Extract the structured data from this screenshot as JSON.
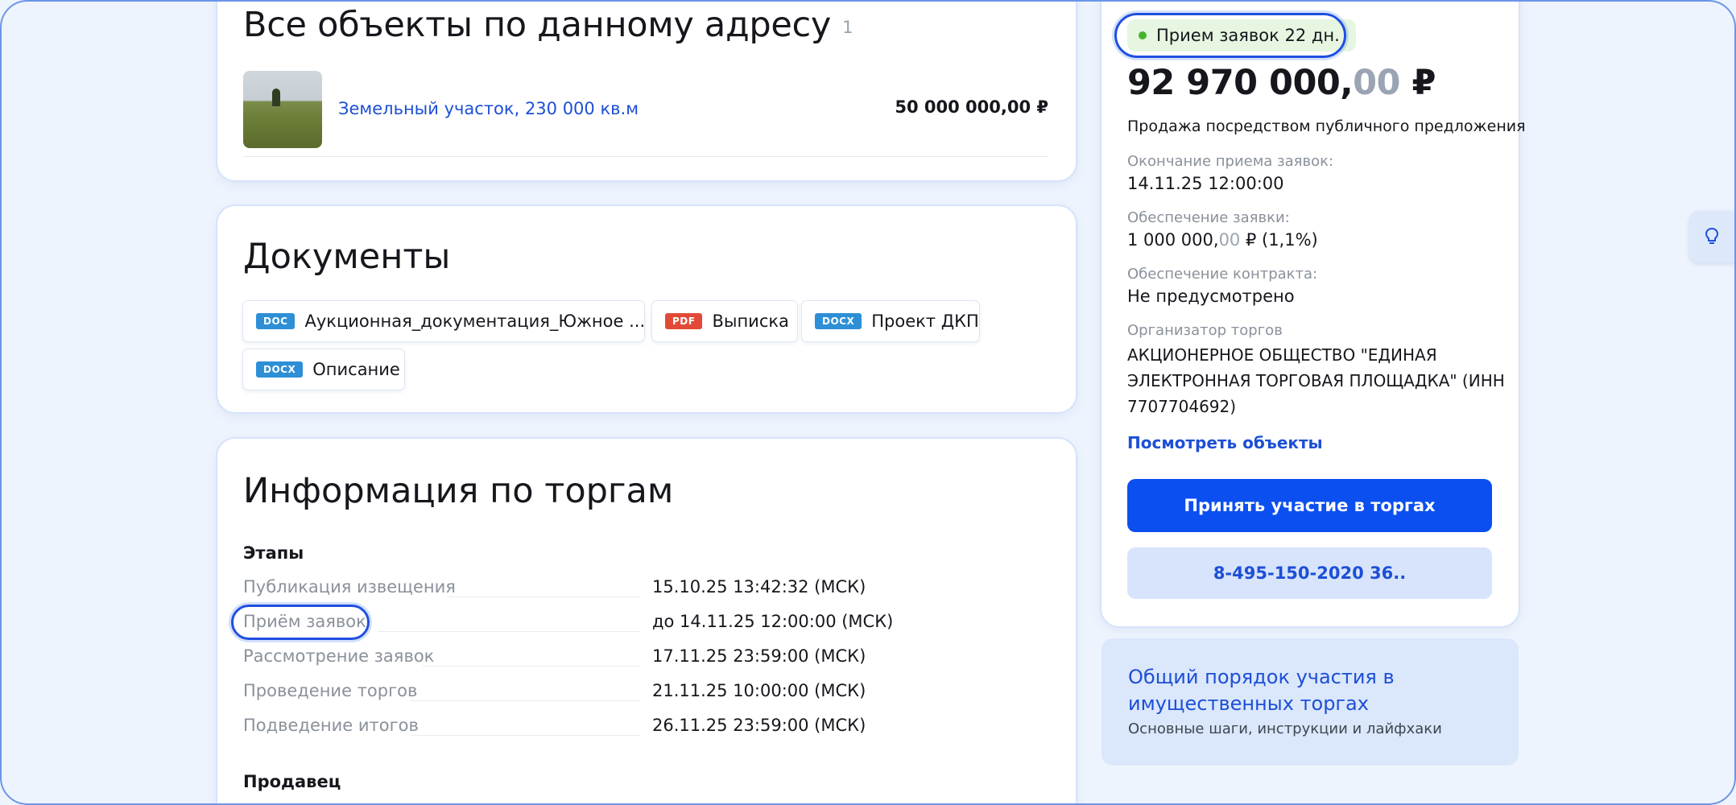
{
  "objects": {
    "title": "Все объекты по данному адресу",
    "count": "1",
    "item": {
      "link": "Земельный участок, 230 000 кв.м",
      "price": "50 000 000,00 ₽"
    }
  },
  "documents": {
    "title": "Документы",
    "files": [
      {
        "type": "DOC",
        "name": "Аукционная_документация_Южное ..."
      },
      {
        "type": "PDF",
        "name": "Выписка"
      },
      {
        "type": "DOCX",
        "name": "Проект ДКП"
      },
      {
        "type": "DOCX",
        "name": "Описание"
      }
    ]
  },
  "info": {
    "title": "Информация по торгам",
    "stages_heading": "Этапы",
    "stages": [
      {
        "label": "Публикация извещения",
        "value": "15.10.25 13:42:32 (МСК)"
      },
      {
        "label": "Приём заявок",
        "value": "до 14.11.25 12:00:00 (МСК)"
      },
      {
        "label": "Рассмотрение заявок",
        "value": "17.11.25 23:59:00 (МСК)"
      },
      {
        "label": "Проведение торгов",
        "value": "21.11.25 10:00:00 (МСК)"
      },
      {
        "label": "Подведение итогов",
        "value": "26.11.25 23:59:00 (МСК)"
      }
    ],
    "seller_heading": "Продавец"
  },
  "side": {
    "status_pill": "Прием заявок 22 дн.",
    "price_main": "92 970 000,",
    "price_cents": "00",
    "price_currency": " ₽",
    "sale_type": "Продажа посредством публичного предложения",
    "end_label": "Окончание приема заявок:",
    "end_value": "14.11.25 12:00:00",
    "deposit_label": "Обеспечение заявки:",
    "deposit_main": "1 000 000,",
    "deposit_cents": "00",
    "deposit_rest": " ₽ (1,1%)",
    "contract_label": "Обеспечение контракта:",
    "contract_value": "Не предусмотрено",
    "organizer_label": "Организатор торгов",
    "organizer_value": "АКЦИОНЕРНОЕ ОБЩЕСТВО \"ЕДИНАЯ ЭЛЕКТРОННАЯ ТОРГОВАЯ ПЛОЩАДКА\" (ИНН 7707704692)",
    "view_objects_link": "Посмотреть объекты",
    "participate_button": "Принять участие в торгах",
    "phone_button": "8-495-150-2020 36.."
  },
  "help": {
    "title": "Общий порядок участия в имущественных торгах",
    "subtitle": "Основные шаги, инструкции и лайфхаки"
  },
  "colors": {
    "accent": "#0b4ff0",
    "link": "#1d4fd6",
    "status_green": "#43b52c",
    "pdf_red": "#e24a37",
    "doc_blue": "#2d8fd6"
  },
  "icons": {
    "tip": "lightbulb-icon",
    "status": "status-dot-icon"
  }
}
